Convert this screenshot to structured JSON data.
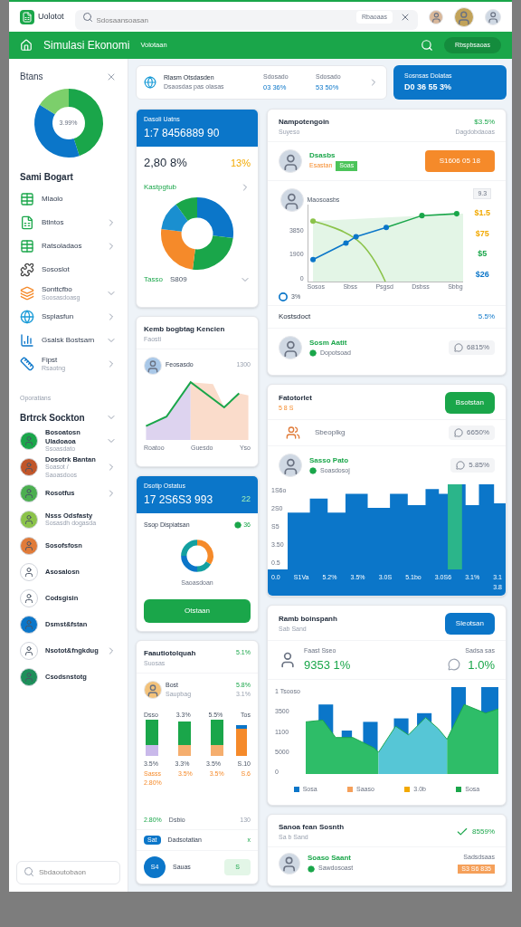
{
  "top_bar": {
    "logo": "Uolotot",
    "search": {
      "placeholder": "Sdosaansoasan"
    },
    "search_chip": "Rbaoaas"
  },
  "header": {
    "title": "Simulasi Ekonomi",
    "subtitle": "Volotaan",
    "button": "Rbspbsaoas"
  },
  "sidebar": {
    "title": "Btans",
    "donut_label": "3.99%",
    "section_title": "Sami Bogart",
    "items": [
      {
        "kind": "table",
        "label": "Mlaolo"
      },
      {
        "kind": "sheet",
        "label": "Btlntos",
        "expanded": false
      },
      {
        "kind": "table",
        "label": "Ratsoladaos",
        "expanded": false
      },
      {
        "kind": "puzzle",
        "label": "Sososlot"
      },
      {
        "kind": "layers",
        "label": "Sonttcfbo",
        "sublabel": "Soosasdoasg",
        "expanded": true
      },
      {
        "kind": "globe",
        "label": "Ssplasfun",
        "expanded": false
      },
      {
        "kind": "chart",
        "label": "Gsalsk Bostsarn",
        "expanded": true
      },
      {
        "kind": "ruler",
        "label": "Fipst",
        "sublabel": "Rsaotng",
        "expanded": false
      }
    ],
    "group_label": "Oporatians",
    "group_title": "Brtrck Sockton",
    "group_expanded": true,
    "contacts": [
      {
        "name": "Bosoatosn Uladoaoa",
        "sub": "Ssoasdato",
        "expanded": true,
        "color": "#1aa64a"
      },
      {
        "name": "Dosotrk Bantan",
        "sub": "Soasot / Saoasdoos",
        "expanded": false,
        "color": "#c0562a"
      },
      {
        "name": "Rosotfus",
        "expanded": false,
        "color": "#4caf50"
      },
      {
        "name": "Nsss Odsfasty",
        "sub": "Sosasdh dogasda",
        "color": "#8bc34a"
      },
      {
        "name": "Sosofsfosn",
        "color": "#e07b39"
      },
      {
        "name": "Asosalosn",
        "color": "#ffffff"
      },
      {
        "name": "Codsgisin",
        "color": "#ffffff"
      },
      {
        "name": "Dsmst&fstan",
        "color": "#0b76c9"
      },
      {
        "name": "Nsotot&fngkdug",
        "expanded": false,
        "color": "#ffffff"
      },
      {
        "name": "Csodsnstotg",
        "color": "#1e8f5a"
      }
    ],
    "footer_search": {
      "placeholder": "Sbdaoutobaon"
    }
  },
  "summary": {
    "title": "Rlasm Otsdasden",
    "subtitle": "Dsaosdas pas olasas",
    "stats": [
      {
        "label": "Sdosado",
        "value": "03 36%"
      },
      {
        "label": "Sdosado",
        "value": "53 50%"
      }
    ]
  },
  "highlight": {
    "label": "Sosnsas Dolatas",
    "value": "D0 36 55 3%"
  },
  "balance_card": {
    "label": "Dasoli Uatns",
    "value": "1:7 8456889 90",
    "main": "2,80 8%",
    "change": "13%",
    "section": "Kastpgtub",
    "footer_label": "Tasso",
    "footer_value": "S809"
  },
  "trend_card": {
    "title": "Kemb bogbtag Kencien",
    "subtitle": "Faosti",
    "name": "Feosasdo",
    "value": "1300",
    "legend": [
      "Roatoo",
      "Guesdo",
      "Yso"
    ]
  },
  "status_card": {
    "label": "Dsotip Ostatus",
    "value": "17  2S6S3 993",
    "badge": "22",
    "section": "Ssop Dispiatsan",
    "section_value": "36",
    "ring_label": "Saoasdoan",
    "button": "Otstaan"
  },
  "bars_card": {
    "title": "Faautiotolquah",
    "title_value": "5.1%",
    "subtitle": "Suosas",
    "name": "Bost",
    "name_sub": "Saupbag",
    "value": "5.8%",
    "value_sub": "3.1%",
    "top_labels": [
      "Dsso",
      "3.3%",
      "5.5%",
      "Tos"
    ],
    "bottom_labels": [
      "3.5%",
      "3.3%",
      "3.5%",
      "S.10"
    ],
    "colored_labels": [
      "Sasss",
      "3.5%",
      "3.5%",
      "S.6"
    ],
    "extra_label": "2.80%",
    "footer_value": "2.80%",
    "footer_label": "Dsbio",
    "footer_num": "130",
    "rows": [
      {
        "label": "Dadsotatian",
        "tag": "Sat",
        "action": "x"
      },
      {
        "label": "Sauas",
        "tag": "S4",
        "action": "S"
      }
    ]
  },
  "growth_card": {
    "title": "Nampotengoin",
    "title_value": "$3.5%",
    "subtitle": "Suyeso",
    "subtitle_right": "Dagdobdaoas",
    "person": "Dsasbs",
    "person_sub": "Esastan",
    "person_tag": "Soas",
    "button": "S1606 05 18",
    "chart_title": "Maosoasbs",
    "chart_chip": "9.3",
    "y_labels": [
      "3850",
      "1900",
      "0"
    ],
    "x_labels": [
      "Sosos",
      "Sbss",
      "Psgsd",
      "Dsbss",
      "Sbbg"
    ],
    "side_values": [
      {
        "text": "$1.5",
        "color": "#f2a900"
      },
      {
        "text": "$75",
        "color": "#f2a900"
      },
      {
        "text": "$5",
        "color": "#1aa64a"
      },
      {
        "text": "$26",
        "color": "#0b76c9"
      }
    ],
    "legend": "3%",
    "row_title": "Kostsdoct",
    "row_value": "5.5%",
    "contact": {
      "name": "Sosm Aatit",
      "sub": "Dopotsoad",
      "chip": "6815%"
    }
  },
  "factor_card": {
    "title": "Fatotorlet",
    "subtitle": "5 8 S",
    "button": "Bsotstan",
    "group_text": "Sbeoplkg",
    "group_chip": "6650%",
    "contact": {
      "name": "Sasso Pato",
      "sub": "Soasdosoj",
      "chip": "5.85%"
    },
    "y_labels": [
      "1S6o",
      "2S0",
      "S5",
      "3.50",
      "0.5"
    ],
    "x_labels": [
      "0.0",
      "S1Va",
      "5.2%",
      "3.5%",
      "3.0S",
      "5.1bo",
      "3.0S6",
      "3.1%",
      "3.1"
    ],
    "corner_label": "3.8"
  },
  "compare_card": {
    "title": "Ramb boinspanh",
    "subtitle": "Sab Sand",
    "button": "Sleotsan",
    "left_label": "Faast Sseo",
    "left_value": "9353 1%",
    "right_label": "Sadsa sas",
    "right_value": "1.0%",
    "y_labels": [
      "1 Tsooso",
      "3500",
      "1100",
      "5000",
      "0"
    ],
    "legend": [
      {
        "text": "Sosa",
        "color": "#0b76c9"
      },
      {
        "text": "Saaso",
        "color": "#f5a05a"
      },
      {
        "text": "3.0b",
        "color": "#f2a900"
      },
      {
        "text": "Sosa",
        "color": "#1aa64a"
      }
    ]
  },
  "month_card": {
    "title": "Sanoa fean Sosnth",
    "subtitle": "Sa b Sand",
    "check_value": "8559%",
    "contact": {
      "name": "Soaso Saant",
      "sub": "Sawdosoast"
    },
    "right_label": "Sadsdsaas",
    "tag": "S3 S6 835"
  }
}
